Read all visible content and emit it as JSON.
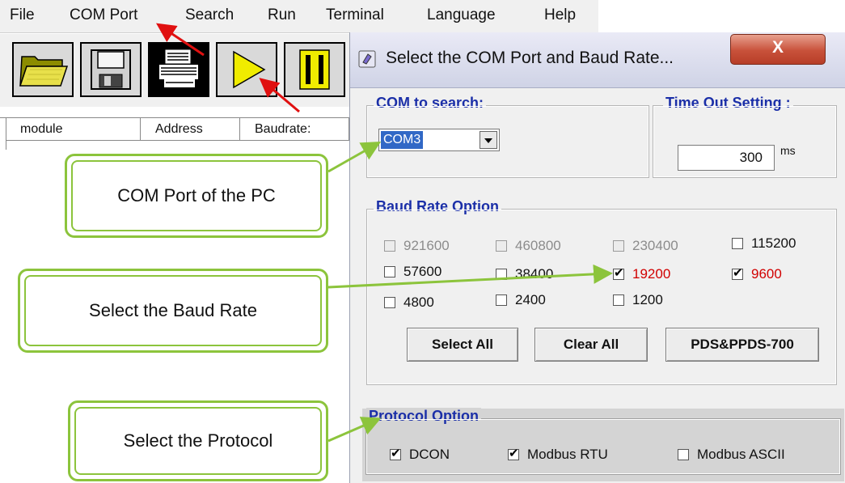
{
  "menubar": {
    "items": [
      "File",
      "COM Port",
      "Search",
      "Run",
      "Terminal",
      "Language",
      "Help"
    ]
  },
  "toolbar": {
    "buttons": [
      "open-folder-icon",
      "save-disk-icon",
      "printer-icon",
      "play-icon",
      "pause-icon"
    ]
  },
  "module_table": {
    "columns": [
      "module",
      "Address",
      "Baudrate:"
    ]
  },
  "dialog": {
    "title": "Select the COM Port and Baud Rate...",
    "close_label": "X",
    "com_group": {
      "legend": "COM to search:",
      "selected": "COM3"
    },
    "timeout_group": {
      "legend": "Time Out Setting :",
      "value": "300",
      "unit": "ms"
    },
    "baud_group": {
      "legend": "Baud Rate Option",
      "options": [
        {
          "label": "921600",
          "checked": false,
          "enabled": false
        },
        {
          "label": "460800",
          "checked": false,
          "enabled": false
        },
        {
          "label": "230400",
          "checked": false,
          "enabled": false
        },
        {
          "label": "115200",
          "checked": false,
          "enabled": true
        },
        {
          "label": "57600",
          "checked": false,
          "enabled": true
        },
        {
          "label": "38400",
          "checked": false,
          "enabled": true
        },
        {
          "label": "19200",
          "checked": true,
          "enabled": true
        },
        {
          "label": "9600",
          "checked": true,
          "enabled": true
        },
        {
          "label": "4800",
          "checked": false,
          "enabled": true
        },
        {
          "label": "2400",
          "checked": false,
          "enabled": true
        },
        {
          "label": "1200",
          "checked": false,
          "enabled": true
        }
      ],
      "buttons": {
        "select_all": "Select All",
        "clear_all": "Clear All",
        "pds": "PDS&PPDS-700"
      }
    },
    "protocol_group": {
      "legend": "Protocol Option",
      "options": [
        {
          "label": "DCON",
          "checked": true
        },
        {
          "label": "Modbus RTU",
          "checked": true
        },
        {
          "label": "Modbus ASCII",
          "checked": false
        }
      ]
    }
  },
  "callouts": {
    "com_port": "COM Port of the PC",
    "baud_rate": "Select the Baud Rate",
    "protocol": "Select the Protocol"
  },
  "colors": {
    "legend_blue": "#1b2fa8",
    "checked_red": "#d10000",
    "callout_green": "#8cc43c",
    "arrow_red": "#e01010"
  }
}
